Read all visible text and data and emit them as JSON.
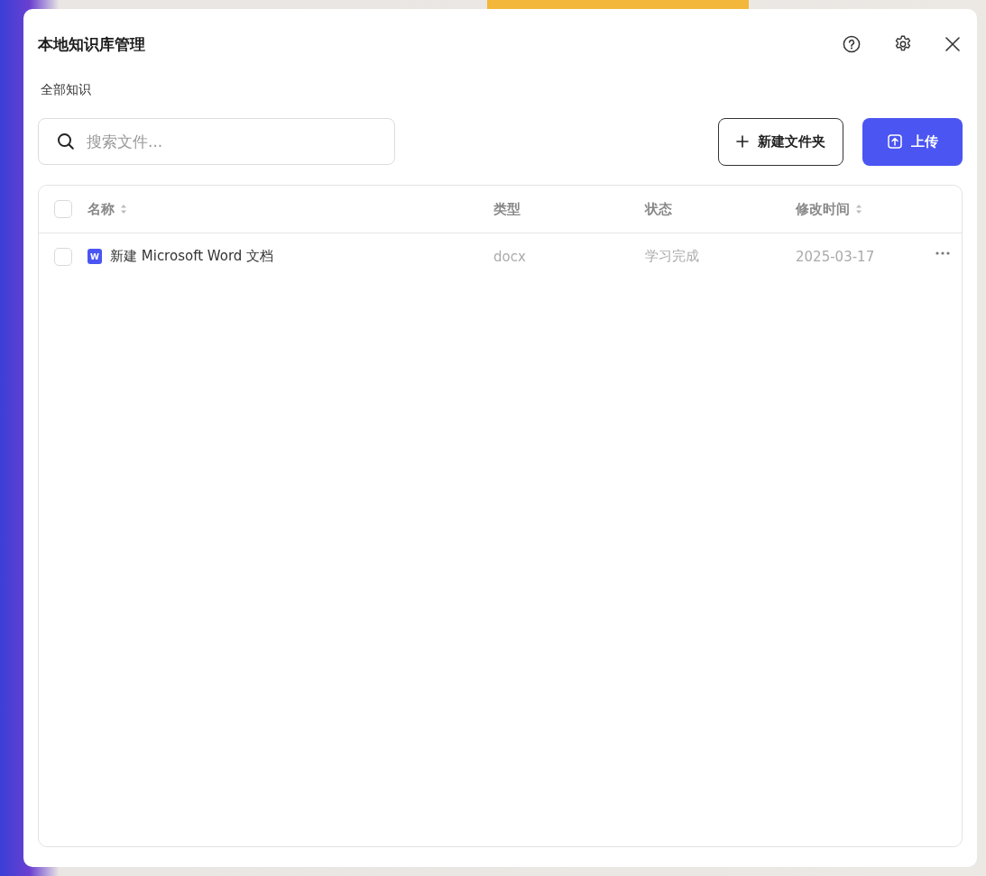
{
  "dialog": {
    "title": "本地知识库管理"
  },
  "breadcrumb": "全部知识",
  "search": {
    "placeholder": "搜索文件..."
  },
  "buttons": [
    {
      "kind": "outline",
      "label": "新建文件夹"
    },
    {
      "kind": "primary",
      "label": "上传"
    }
  ],
  "table": {
    "select_all": {
      "checked": false
    },
    "columns": [
      {
        "label": "名称",
        "sortable": true
      },
      {
        "label": "类型",
        "sortable": false
      },
      {
        "label": "状态",
        "sortable": false
      },
      {
        "label": "修改时间",
        "sortable": true
      }
    ],
    "rows": [
      {
        "checked": false,
        "icon_letter": "W",
        "name": "新建 Microsoft Word 文档",
        "type": "docx",
        "status": "学习完成",
        "modified": "2025-03-17"
      }
    ]
  }
}
